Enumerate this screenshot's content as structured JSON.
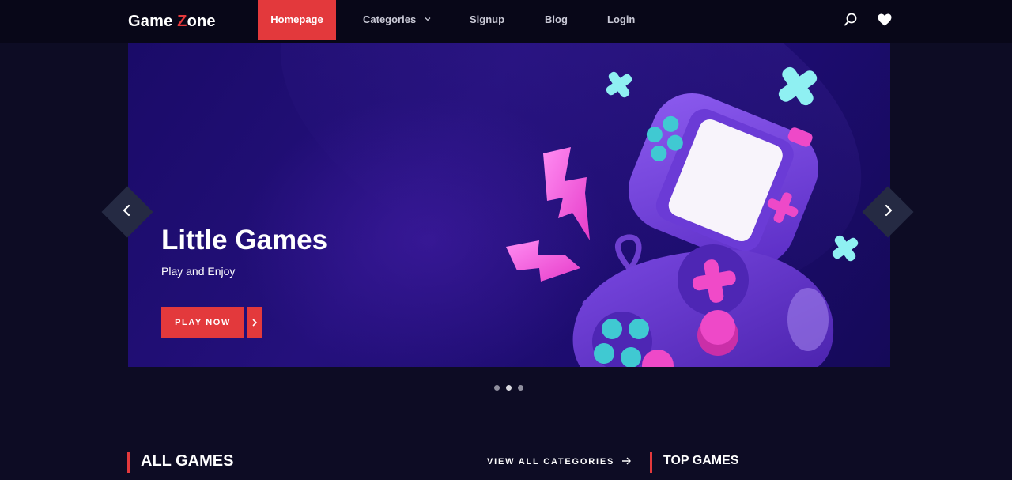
{
  "logo": {
    "part1": "Game ",
    "highlight": "Z",
    "part2": "one"
  },
  "nav": {
    "items": [
      {
        "label": "Homepage",
        "active": true
      },
      {
        "label": "Categories",
        "has_dropdown": true
      },
      {
        "label": "Signup"
      },
      {
        "label": "Blog"
      },
      {
        "label": "Login"
      }
    ]
  },
  "header_icons": [
    "search-icon",
    "heart-icon"
  ],
  "hero": {
    "title": "Little Games",
    "subtitle": "Play and Enjoy",
    "cta_label": "PLAY NOW",
    "slides_total": 3,
    "active_slide": 2
  },
  "sections": {
    "all_games": {
      "title": "ALL GAMES",
      "view_all_label": "VIEW ALL CATEGORIES"
    },
    "top_games": {
      "title": "TOP GAMES"
    }
  },
  "colors": {
    "accent": "#e3393c",
    "background": "#0d0c24",
    "header": "#080718",
    "hero_purple": "#24107c"
  }
}
